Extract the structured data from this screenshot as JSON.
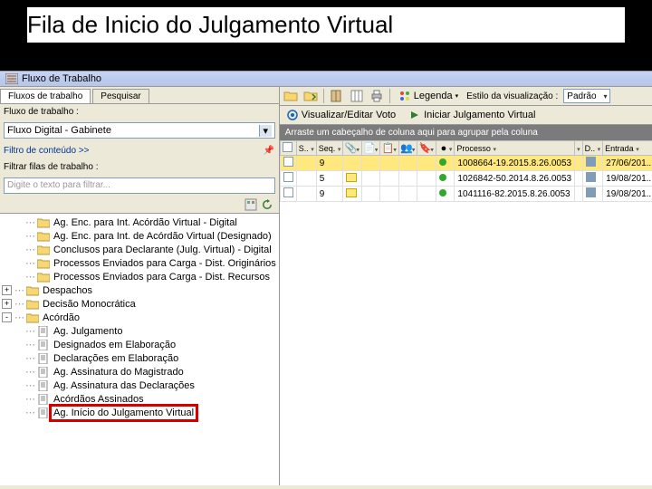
{
  "slide": {
    "title": "Fila de Inicio do Julgamento Virtual"
  },
  "titlebar": {
    "text": "Fluxo de Trabalho"
  },
  "left_panel": {
    "tabs": [
      {
        "label": "Fluxos de trabalho",
        "active": true
      },
      {
        "label": "Pesquisar",
        "active": false
      }
    ],
    "fluxo_label": "Fluxo de trabalho :",
    "fluxo_value": "Fluxo Digital - Gabinete",
    "filtro_link": "Filtro de conteúdo >>",
    "filtrar_label": "Filtrar filas de trabalho :",
    "filtrar_placeholder": "Digite o texto para filtrar...",
    "tree": [
      {
        "level": 1,
        "exp": "",
        "icon": "folder",
        "label": "Ag. Enc. para Int. Acórdão Virtual - Digital"
      },
      {
        "level": 1,
        "exp": "",
        "icon": "folder",
        "label": "Ag. Enc. para Int. de Acórdão Virtual (Designado)"
      },
      {
        "level": 1,
        "exp": "",
        "icon": "folder",
        "label": "Conclusos para Declarante (Julg. Virtual) - Digital"
      },
      {
        "level": 1,
        "exp": "",
        "icon": "folder",
        "label": "Processos Enviados para Carga - Dist. Originários"
      },
      {
        "level": 1,
        "exp": "",
        "icon": "folder",
        "label": "Processos Enviados para Carga - Dist. Recursos"
      },
      {
        "level": 0,
        "exp": "+",
        "icon": "folder",
        "label": "Despachos"
      },
      {
        "level": 0,
        "exp": "+",
        "icon": "folder",
        "label": "Decisão Monocrática"
      },
      {
        "level": 0,
        "exp": "-",
        "icon": "folder",
        "label": "Acórdão"
      },
      {
        "level": 1,
        "exp": "",
        "icon": "doc",
        "label": "Ag. Julgamento"
      },
      {
        "level": 1,
        "exp": "",
        "icon": "doc",
        "label": "Designados em Elaboração"
      },
      {
        "level": 1,
        "exp": "",
        "icon": "doc",
        "label": "Declarações em Elaboração"
      },
      {
        "level": 1,
        "exp": "",
        "icon": "doc",
        "label": "Ag. Assinatura do Magistrado"
      },
      {
        "level": 1,
        "exp": "",
        "icon": "doc",
        "label": "Ag. Assinatura das Declarações"
      },
      {
        "level": 1,
        "exp": "",
        "icon": "doc",
        "label": "Acórdãos Assinados"
      },
      {
        "level": 1,
        "exp": "",
        "icon": "doc",
        "label": "Ag. Início do Julgamento Virtual",
        "highlight": true
      }
    ]
  },
  "right_panel": {
    "toolbar1": {
      "legenda": "Legenda",
      "estilo_label": "Estilo da visualização :",
      "estilo_value": "Padrão"
    },
    "toolbar2": {
      "visualizar": "Visualizar/Editar Voto",
      "iniciar": "Iniciar Julgamento Virtual"
    },
    "groupbar": "Arraste um cabeçalho de coluna aqui para agrupar pela coluna",
    "grid": {
      "headers": [
        "",
        "S..",
        "Seq.",
        "",
        "",
        "",
        "",
        "",
        "",
        "Processo",
        "",
        "D..",
        "Entrada"
      ],
      "rows": [
        {
          "sel": true,
          "chk": false,
          "seq": "9",
          "note": false,
          "dot": "green",
          "processo": "1008664-19.2015.8.26.0053",
          "chk2": true,
          "entrada": "27/06/201..."
        },
        {
          "sel": false,
          "chk": false,
          "seq": "5",
          "note": true,
          "dot": "green",
          "processo": "1026842-50.2014.8.26.0053",
          "chk2": true,
          "entrada": "19/08/201..."
        },
        {
          "sel": false,
          "chk": false,
          "seq": "9",
          "note": true,
          "dot": "green",
          "processo": "1041116-82.2015.8.26.0053",
          "chk2": true,
          "entrada": "19/08/201..."
        }
      ]
    }
  }
}
